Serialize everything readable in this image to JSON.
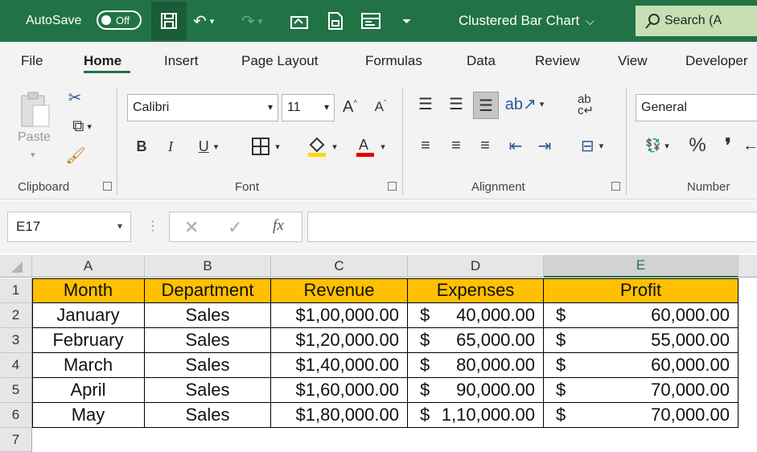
{
  "titlebar": {
    "autosave_label": "AutoSave",
    "autosave_state": "Off",
    "doc_title": "Clustered Bar Chart",
    "search_placeholder": "Search (A",
    "accent": "#217346"
  },
  "tabs": [
    "File",
    "Home",
    "Insert",
    "Page Layout",
    "Formulas",
    "Data",
    "Review",
    "View",
    "Developer"
  ],
  "ribbon": {
    "clipboard": {
      "label": "Clipboard",
      "paste_label": "Paste"
    },
    "font": {
      "label": "Font",
      "font_name": "Calibri",
      "font_size": "11",
      "bold": "B",
      "italic": "I",
      "underline": "U"
    },
    "alignment": {
      "label": "Alignment"
    },
    "number": {
      "label": "Number",
      "format": "General",
      "percent": "%",
      "comma": "❜"
    }
  },
  "formula_bar": {
    "name_box": "E17",
    "fx": "fx",
    "value": ""
  },
  "sheet": {
    "columns": [
      "A",
      "B",
      "C",
      "D",
      "E"
    ],
    "rows": [
      "1",
      "2",
      "3",
      "4",
      "5",
      "6",
      "7"
    ],
    "header": [
      "Month",
      "Department",
      "Revenue",
      "Expenses",
      "Profit"
    ],
    "data": [
      {
        "month": "January",
        "dept": "Sales",
        "revenue": "$1,00,000.00",
        "exp_sym": "$",
        "expenses": "40,000.00",
        "profit_sym": "$",
        "profit": "60,000.00"
      },
      {
        "month": "February",
        "dept": "Sales",
        "revenue": "$1,20,000.00",
        "exp_sym": "$",
        "expenses": "65,000.00",
        "profit_sym": "$",
        "profit": "55,000.00"
      },
      {
        "month": "March",
        "dept": "Sales",
        "revenue": "$1,40,000.00",
        "exp_sym": "$",
        "expenses": "80,000.00",
        "profit_sym": "$",
        "profit": "60,000.00"
      },
      {
        "month": "April",
        "dept": "Sales",
        "revenue": "$1,60,000.00",
        "exp_sym": "$",
        "expenses": "90,000.00",
        "profit_sym": "$",
        "profit": "70,000.00"
      },
      {
        "month": "May",
        "dept": "Sales",
        "revenue": "$1,80,000.00",
        "exp_sym": "$",
        "expenses": "1,10,000.00",
        "profit_sym": "$",
        "profit": "70,000.00"
      }
    ],
    "header_fill": "#ffc000"
  }
}
